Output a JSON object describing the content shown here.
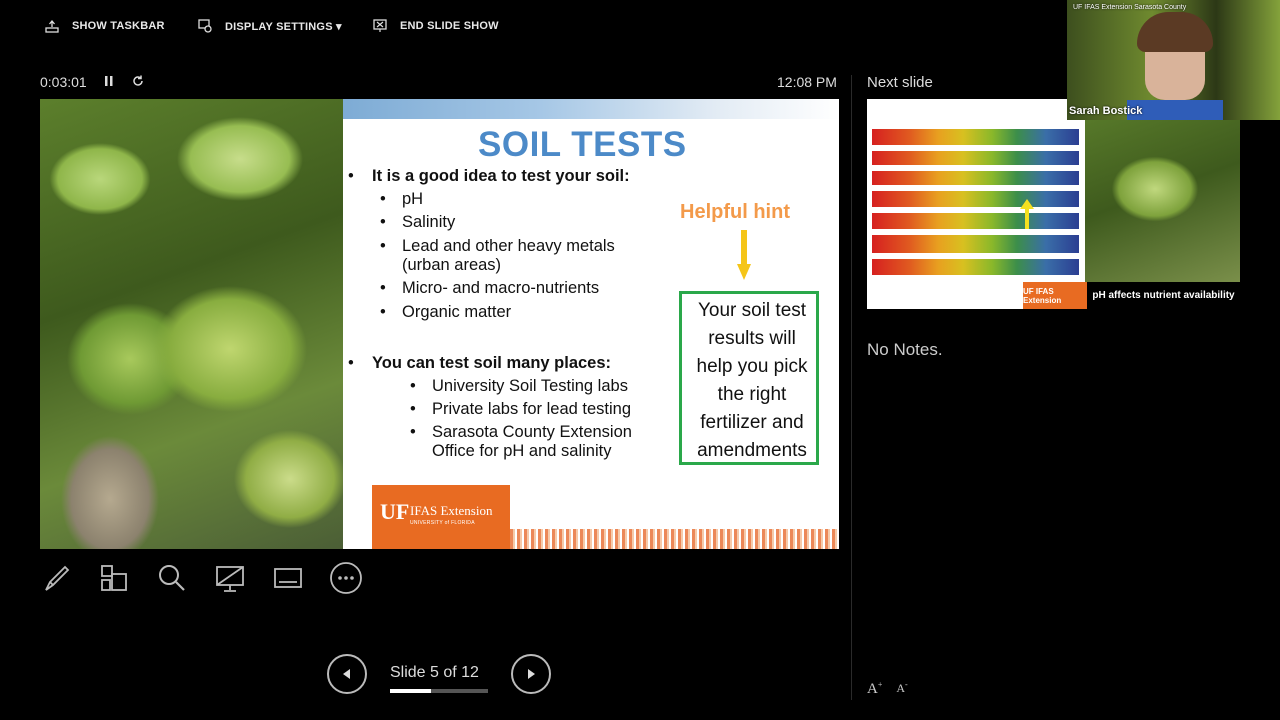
{
  "toolbar": {
    "show_taskbar": "SHOW TASKBAR",
    "display_settings": "DISPLAY SETTINGS ▾",
    "end_slide_show": "END SLIDE SHOW"
  },
  "status": {
    "timer": "0:03:01",
    "clock": "12:08 PM",
    "next_slide_label": "Next slide"
  },
  "slide": {
    "title": "SOIL TESTS",
    "section1_heading": "It is a good idea to test your soil:",
    "section1_items": [
      "pH",
      "Salinity",
      "Lead and other heavy metals",
      "(urban areas)",
      "Micro- and macro-nutrients",
      "Organic matter"
    ],
    "section2_heading": "You can test soil many places:",
    "section2_items": [
      "University Soil Testing labs",
      "Private labs for lead testing",
      "Sarasota County Extension",
      "Office for pH and salinity"
    ],
    "hint_title": "Helpful hint",
    "hint_lines": [
      "Your soil test",
      "results will",
      "help you pick",
      "the right",
      "fertilizer and",
      "amendments"
    ],
    "logo_mark": "UF",
    "logo_text": "IFAS Extension",
    "logo_sub": "UNIVERSITY of FLORIDA"
  },
  "controls": {
    "slide_counter": "Slide 5 of 12",
    "progress": 0.42
  },
  "next_slide": {
    "caption": "pH affects nutrient availability",
    "logo_text": "UF IFAS Extension"
  },
  "notes": {
    "text": "No Notes."
  },
  "video": {
    "participant": "Sarah Bostick",
    "banner": "UF IFAS Extension Sarasota County"
  },
  "colors": {
    "title_blue": "#4c8ac8",
    "hint_orange": "#f39a4a",
    "box_green": "#2aa84a",
    "uf_orange": "#e86b22"
  }
}
